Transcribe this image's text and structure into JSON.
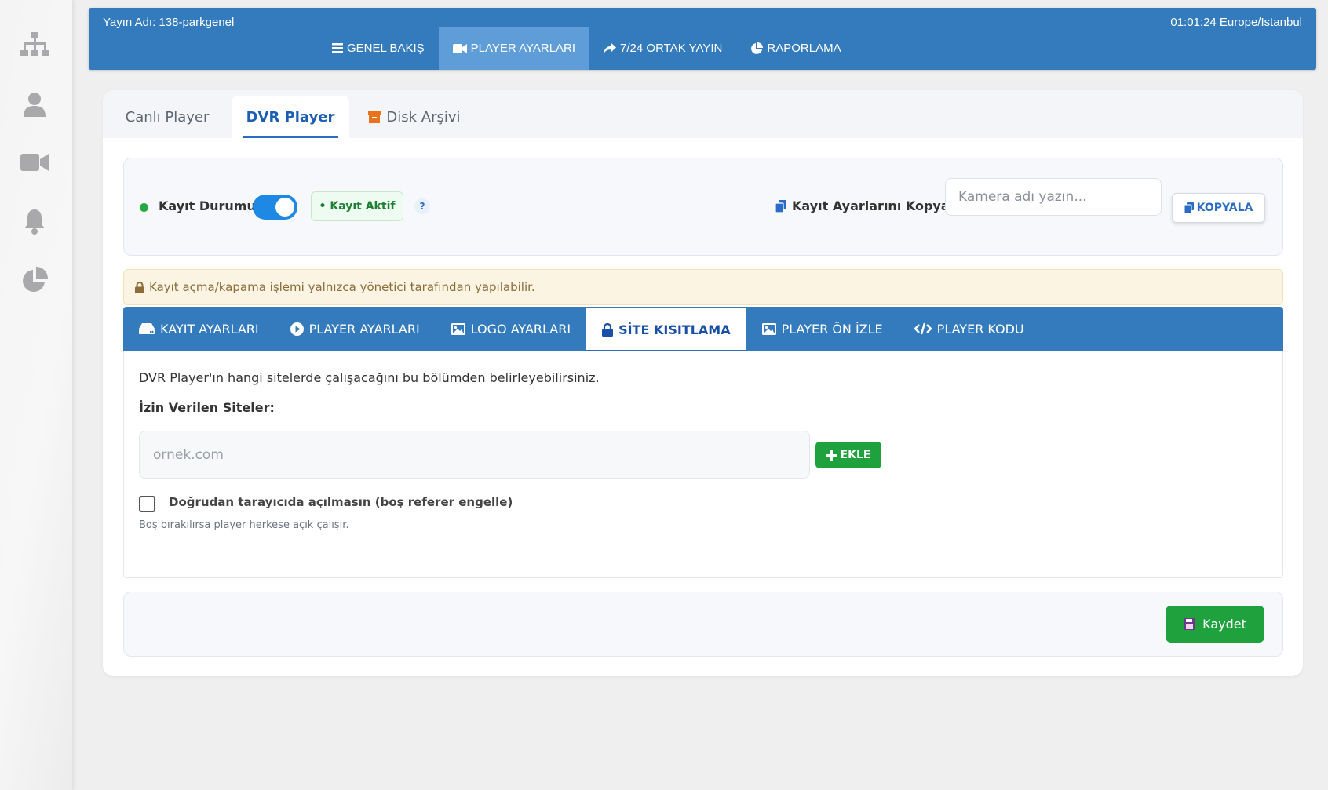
{
  "header": {
    "stream_name": "Yayın Adı: 138-parkgenel",
    "clock": "01:01:24 Europe/Istanbul",
    "nav": [
      {
        "label": "GENEL BAKIŞ",
        "icon": "list-icon"
      },
      {
        "label": "PLAYER AYARLARI",
        "icon": "video-camera-icon",
        "active": true
      },
      {
        "label": "7/24 ORTAK YAYIN",
        "icon": "share-icon"
      },
      {
        "label": "RAPORLAMA",
        "icon": "pie-chart-icon"
      }
    ]
  },
  "sidebar": {
    "icons": [
      "sitemap-icon",
      "user-icon",
      "video-camera-icon",
      "bell-icon",
      "pie-chart-icon"
    ],
    "color": "#a9a9ab"
  },
  "card_tabs": [
    {
      "label": "Canlı Player"
    },
    {
      "label": "DVR Player",
      "active": true
    },
    {
      "label": "Disk Arşivi",
      "icon": "archive-box-icon"
    }
  ],
  "status": {
    "label": "Kayıt Durumu:",
    "toggle_on": true,
    "badge": "• Kayıt Aktif",
    "help": "?",
    "copy_label": "Kayıt Ayarlarını Kopyala:",
    "copy_placeholder": "Kamera adı yazın...",
    "copy_button": "KOPYALA"
  },
  "warning": "Kayıt açma/kapama işlemi yalnızca yönetici tarafından yapılabilir.",
  "sub_tabs": [
    {
      "label": "KAYIT AYARLARI",
      "icon": "hard-drive-icon"
    },
    {
      "label": "PLAYER AYARLARI",
      "icon": "play-circle-icon"
    },
    {
      "label": "LOGO AYARLARI",
      "icon": "image-icon"
    },
    {
      "label": "SİTE KISITLAMA",
      "icon": "lock-icon",
      "active": true
    },
    {
      "label": "PLAYER ÖN İZLE",
      "icon": "image-icon"
    },
    {
      "label": "PLAYER KODU",
      "icon": "code-icon"
    }
  ],
  "site_restriction": {
    "description": "DVR Player'ın hangi sitelerde çalışacağını bu bölümden belirleyebilirsiniz.",
    "allowed_label": "İzin Verilen Siteler:",
    "site_placeholder": "ornek.com",
    "add_button": "EKLE",
    "checkbox_label": "Doğrudan tarayıcıda açılmasın (boş referer engelle)",
    "checkbox_checked": false,
    "hint": "Boş bırakılırsa player herkese açık çalışır."
  },
  "save_button": "Kaydet",
  "colors": {
    "primary": "#347bbd",
    "nav_active": "#5e9dd8",
    "success": "#1fa23e",
    "toggle": "#1e88e5",
    "warning_bg": "#fcf4e3",
    "warning_text": "#8a6d3b"
  }
}
